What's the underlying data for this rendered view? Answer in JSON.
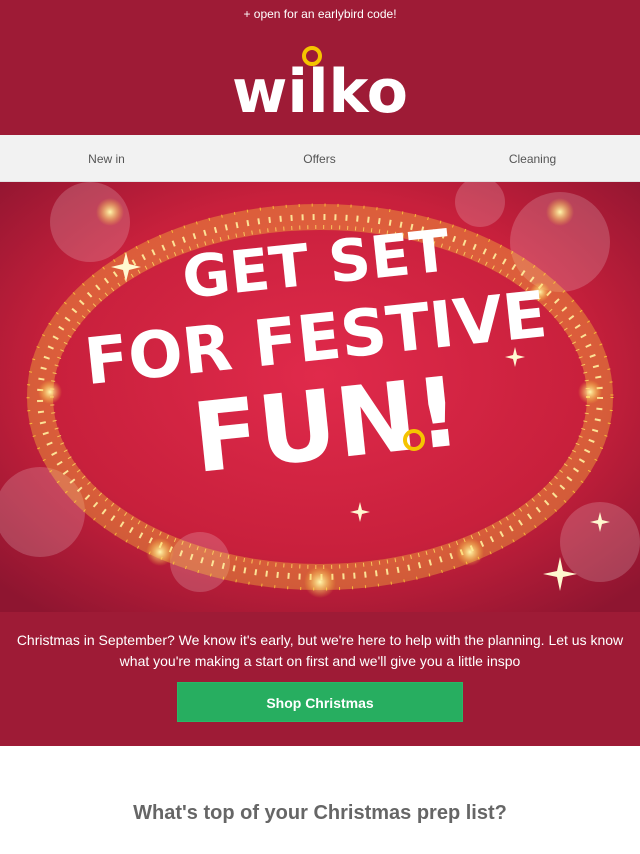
{
  "preheader": "+ open for an earlybird code!",
  "logo": {
    "text": "wilko",
    "brand_color": "#9e1b36",
    "dot_color": "#f5c400"
  },
  "nav": {
    "items": [
      {
        "label": "New in"
      },
      {
        "label": "Offers"
      },
      {
        "label": "Cleaning"
      }
    ]
  },
  "hero": {
    "lines": [
      "GET SET",
      "FOR FESTIVE",
      "FUN!"
    ],
    "colors": {
      "background": "#c8203c",
      "sparkle": "#ffd23a"
    }
  },
  "intro": {
    "text": "Christmas in September? We know it's early, but we're here to help with the planning. Let us know what you're making a start on first and we'll give you a little inspo",
    "cta_label": "Shop Christmas",
    "cta_color": "#27ae60"
  },
  "section": {
    "title": "What's top of your Christmas prep list?"
  }
}
